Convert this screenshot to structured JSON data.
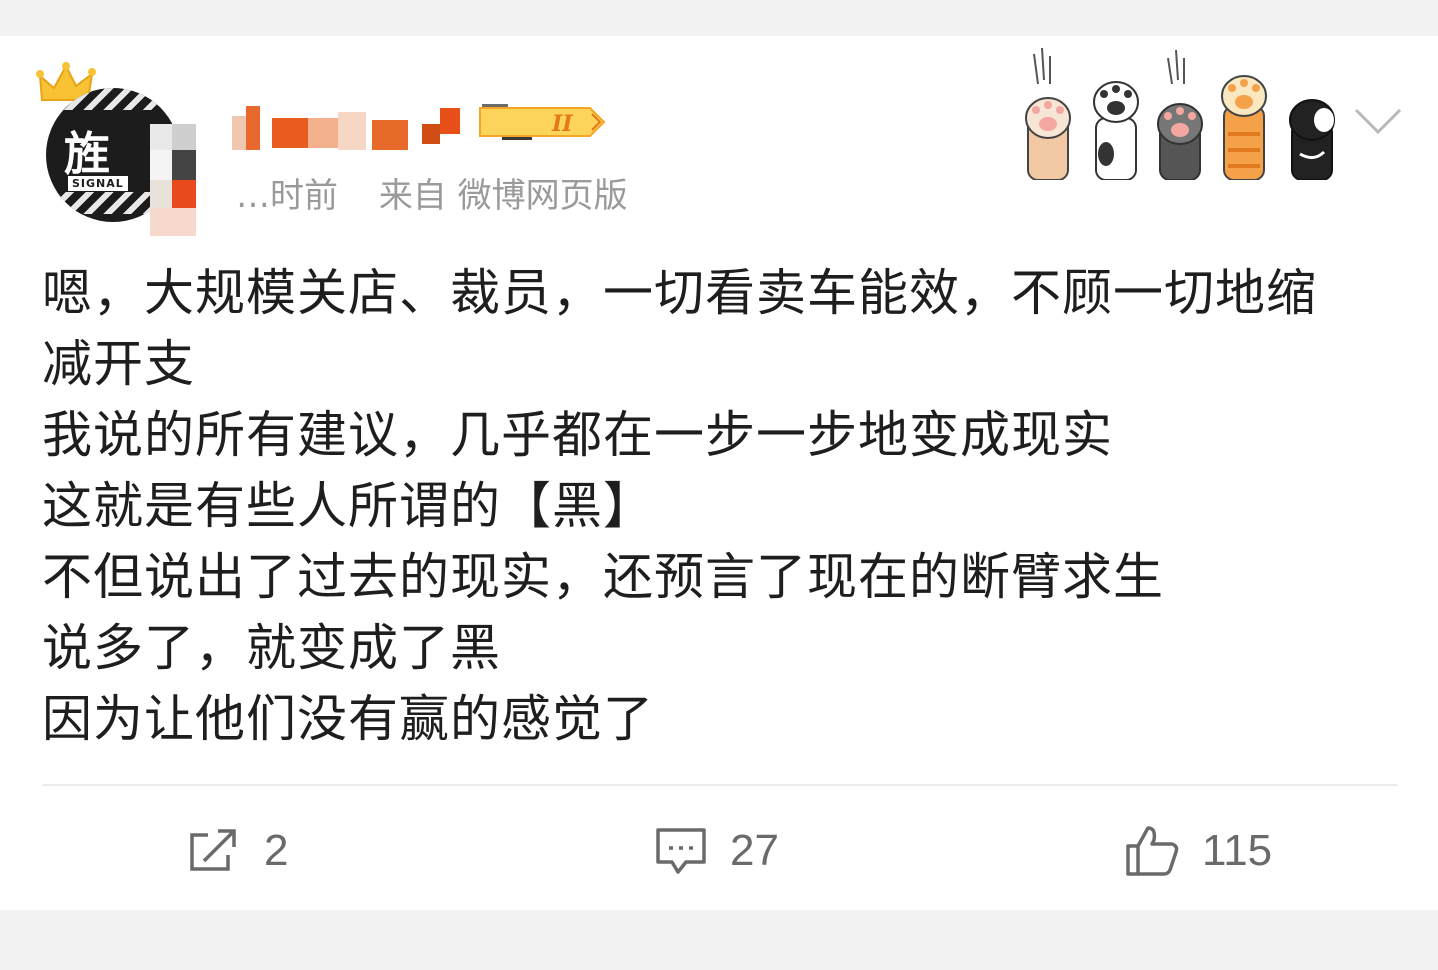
{
  "post": {
    "time_text": "…时前",
    "source_text": "来自 微博网页版",
    "avatar_text": "旌",
    "avatar_signal": "SIGNAL",
    "vip_badge": "II",
    "content_lines": [
      "嗯，大规模关店、裁员，一切看卖车能效，不顾一切地缩",
      "减开支",
      "我说的所有建议，几乎都在一步一步地变成现实",
      "这就是有些人所谓的【黑】",
      "不但说出了过去的现实，还预言了现在的断臂求生",
      "说多了，就变成了黑",
      "因为让他们没有赢的感觉了"
    ]
  },
  "actions": {
    "repost_count": "2",
    "comment_count": "27",
    "like_count": "115"
  },
  "colors": {
    "background": "#f2f2f2",
    "card": "#ffffff",
    "meta_gray": "#9a9a9a",
    "action_gray": "#6a6a6a",
    "badge_orange": "#f5a623"
  }
}
